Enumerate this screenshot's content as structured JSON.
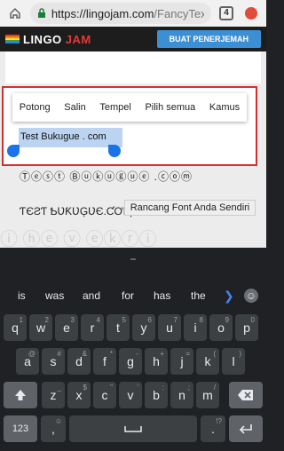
{
  "browser": {
    "url_host": "https://lingojam.com",
    "url_rest": "/FancyTex",
    "tab_count": "4"
  },
  "header": {
    "logo_part1": "LINGO",
    "logo_part2": "JAM",
    "translator_button": "BUAT PENERJEMAH"
  },
  "context_menu": [
    "Potong",
    "Salin",
    "Tempel",
    "Pilih semua",
    "Kamus"
  ],
  "editor": {
    "selected_text": "Test Bukugue . com"
  },
  "fancy_outputs": {
    "circled": "Ⓣⓔⓢⓣ Ⓑⓤⓚⓤⓖⓤⓔ .ⓒⓞⓜ",
    "script": "ƬЄƧƬ ҌƲƘƲĢƲЄ.ƇƠӍ",
    "design_button": "Rancang Font Anda Sendiri",
    "watermark": "ⓘ ⓗⓔ ⓥ ⓔⓚⓡⓘ"
  },
  "keyboard": {
    "suggestions": [
      "is",
      "was",
      "and",
      "for",
      "has",
      "the"
    ],
    "row1": [
      {
        "k": "q",
        "a": "1"
      },
      {
        "k": "w",
        "a": "2"
      },
      {
        "k": "e",
        "a": "3"
      },
      {
        "k": "r",
        "a": "4"
      },
      {
        "k": "t",
        "a": "5"
      },
      {
        "k": "y",
        "a": "6"
      },
      {
        "k": "u",
        "a": "7"
      },
      {
        "k": "i",
        "a": "8"
      },
      {
        "k": "o",
        "a": "9"
      },
      {
        "k": "p",
        "a": "0"
      }
    ],
    "row2": [
      {
        "k": "a",
        "a": "@"
      },
      {
        "k": "s",
        "a": "#"
      },
      {
        "k": "d",
        "a": "&"
      },
      {
        "k": "f",
        "a": "*"
      },
      {
        "k": "g",
        "a": "-"
      },
      {
        "k": "h",
        "a": "+"
      },
      {
        "k": "j",
        "a": "="
      },
      {
        "k": "k",
        "a": "("
      },
      {
        "k": "l",
        "a": ")"
      }
    ],
    "row3": [
      {
        "k": "z",
        "a": "_"
      },
      {
        "k": "x",
        "a": "$"
      },
      {
        "k": "c",
        "a": "\""
      },
      {
        "k": "v",
        "a": "'"
      },
      {
        "k": "b",
        "a": ":"
      },
      {
        "k": "n",
        "a": ";"
      },
      {
        "k": "m",
        "a": "/"
      }
    ],
    "symbols_key": "123",
    "comma_key": ",",
    "period_key": ".",
    "comma_alt": "☺",
    "period_alt": "!?"
  }
}
